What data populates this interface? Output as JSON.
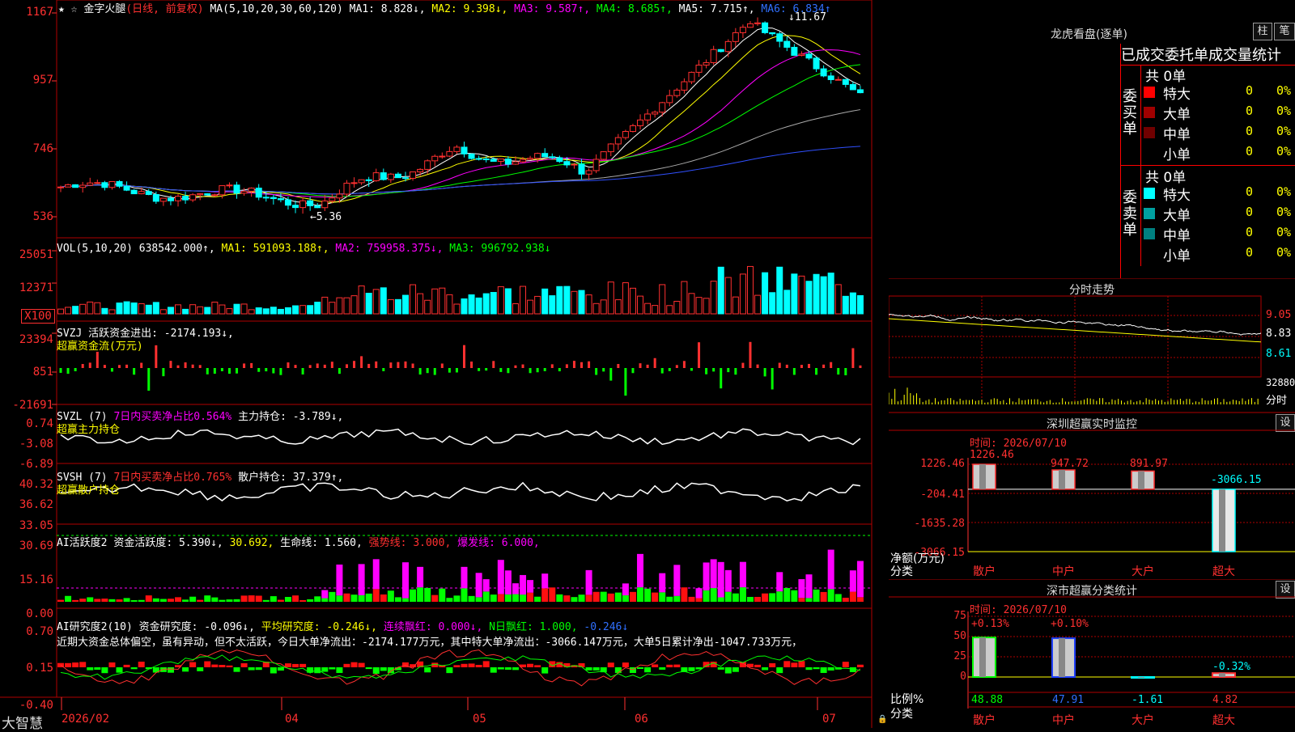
{
  "stock_name": "金字火腿",
  "period": "(日线, 前复权)",
  "ma_header": {
    "label": "MA(5,10,20,30,60,120)",
    "ma1": "MA1: 8.828↓,",
    "ma2": "MA2: 9.398↓,",
    "ma3": "MA3: 9.587↑,",
    "ma4": "MA4: 8.685↑,",
    "ma5": "MA5: 7.715↑,",
    "ma6": "MA6: 6.834↑"
  },
  "price_axis": [
    "1167",
    "957",
    "746",
    "536"
  ],
  "price_high_label": "11.67",
  "price_low_label": "←5.36",
  "vol_header": {
    "label": "VOL(5,10,20)",
    "value": "638542.000↑,",
    "ma1": "MA1: 591093.188↑,",
    "ma2": "MA2: 759958.375↓,",
    "ma3": "MA3: 996792.938↓"
  },
  "vol_axis": [
    "25051",
    "12371",
    "X100"
  ],
  "svzj_header": {
    "label": "SVZJ",
    "text": "活跃资金进出: -2174.193↓,",
    "subtitle": "超赢资金流(万元)"
  },
  "svzj_axis": [
    "23394",
    "851",
    "-21691"
  ],
  "svzl_header": {
    "label": "SVZL (7)",
    "text1": "7日内买卖净占比0.564%",
    "text2": "主力持仓: -3.789↓,",
    "subtitle": "超赢主力持仓"
  },
  "svzl_axis": [
    "0.74",
    "-3.08",
    "-6.89"
  ],
  "svsh_header": {
    "label": "SVSH (7)",
    "text1": "7日内买卖净占比0.765%",
    "text2": "散户持仓: 37.379↑,",
    "subtitle": "超赢散户持仓"
  },
  "svsh_axis": [
    "40.32",
    "36.62",
    "33.05"
  ],
  "ai1_header": {
    "label": "AI活跃度2",
    "t1": "资金活跃度: 5.390↓,",
    "t2": "30.692,",
    "t3": "生命线: 1.560,",
    "t4": "强势线: 3.000,",
    "t5": "爆发线: 6.000,"
  },
  "ai1_axis": [
    "30.69",
    "15.16",
    "0.00"
  ],
  "ai2_header": {
    "label": "AI研究度2(10)",
    "t1": "资金研究度: -0.096↓,",
    "t2": "平均研究度: -0.246↓,",
    "t3": "连续飘红: 0.000↓,",
    "t4": "N日飘红: 1.000,",
    "t5": "-0.246↓"
  },
  "ai2_comment": "近期大资金总体偏空，虽有异动，但不太活跃，今日大单净流出：-2174.177万元，其中特大单净流出：-3066.147万元，大单5日累计净出-1047.733万元，",
  "ai2_axis": [
    "0.70",
    "0.15",
    "-0.40"
  ],
  "date_axis": [
    "2026/02",
    "04",
    "05",
    "06",
    "07"
  ],
  "app_logo": "大智慧",
  "dragon": {
    "title": "龙虎看盘(逐单)",
    "btn1": "柱",
    "btn2": "笔",
    "tabs": "已成交委托单成交量统计",
    "buy_label": "委买单",
    "sell_label": "委卖单",
    "buy_total": "共 0单",
    "sell_total": "共 0单",
    "buy_rows": [
      {
        "name": "特大",
        "count": "0",
        "pct": "0%",
        "color": "#ff0000"
      },
      {
        "name": "大单",
        "count": "0",
        "pct": "0%",
        "color": "#a00000"
      },
      {
        "name": "中单",
        "count": "0",
        "pct": "0%",
        "color": "#700000"
      },
      {
        "name": "小单",
        "count": "0",
        "pct": "0%",
        "color": ""
      }
    ],
    "sell_rows": [
      {
        "name": "特大",
        "count": "0",
        "pct": "0%",
        "color": "#00ffff"
      },
      {
        "name": "大单",
        "count": "0",
        "pct": "0%",
        "color": "#00a0a0"
      },
      {
        "name": "中单",
        "count": "0",
        "pct": "0%",
        "color": "#008080"
      },
      {
        "name": "小单",
        "count": "0",
        "pct": "0%",
        "color": ""
      }
    ]
  },
  "intraday": {
    "title": "分时走势",
    "axis": [
      "9.05",
      "8.83",
      "8.61",
      "32880"
    ],
    "label": "分时"
  },
  "monitor": {
    "title": "深圳超赢实时监控",
    "settings": "设",
    "time": "时间: 2026/07/10",
    "axis": [
      "1226.46",
      "-204.41",
      "-1635.28",
      "-3066.15"
    ],
    "unit": "净额(万元)",
    "cat_label": "分类",
    "categories": [
      "散户",
      "中户",
      "大户",
      "超大"
    ],
    "values": [
      1226.46,
      947.72,
      891.97,
      -3066.15
    ],
    "value_labels": [
      "1226.46",
      "947.72",
      "891.97",
      "-3066.15"
    ]
  },
  "classify": {
    "title": "深市超赢分类统计",
    "settings": "设",
    "time": "时间: 2026/07/10",
    "axis": [
      "75",
      "50",
      "25",
      "0"
    ],
    "unit": "比例%",
    "cat_label": "分类",
    "categories": [
      "散户",
      "中户",
      "大户",
      "超大"
    ],
    "change_labels": [
      "+0.13%",
      "+0.10%",
      "",
      "-0.32%"
    ],
    "values": [
      "48.88",
      "47.91",
      "-1.61",
      "4.82"
    ]
  }
}
